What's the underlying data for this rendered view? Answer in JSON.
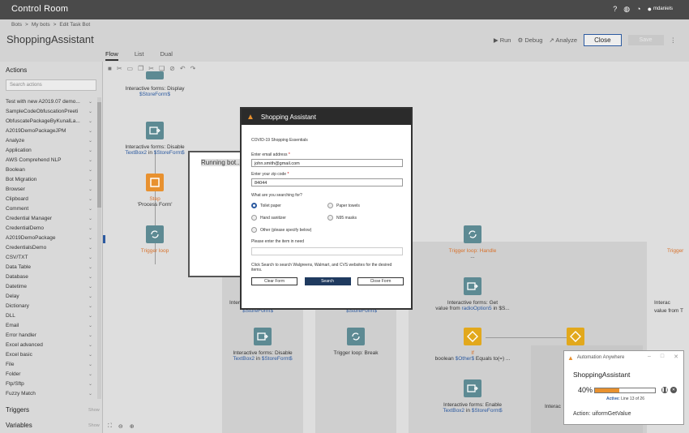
{
  "app": {
    "title": "Control Room",
    "user": "mdaniels"
  },
  "breadcrumb": [
    "Bots",
    ">",
    "My bots",
    ">",
    "Edit Task Bot"
  ],
  "page": {
    "title": "ShoppingAssistant"
  },
  "header_actions": {
    "run": "Run",
    "debug": "Debug",
    "analyze": "Analyze",
    "close": "Close",
    "save": "Save"
  },
  "tabs": [
    "Flow",
    "List",
    "Dual"
  ],
  "sidebar": {
    "title": "Actions",
    "search_placeholder": "Search actions",
    "items": [
      "Test with new A2019.07 demo...",
      "SampleCodeObfuscationPreeti",
      "ObfuscatePackageByKunalLa...",
      "A2019DemoPackageJPM",
      "Analyze",
      "Application",
      "AWS Comprehend NLP",
      "Boolean",
      "Bot Migration",
      "Browser",
      "Clipboard",
      "Comment",
      "Credential Manager",
      "CredentialDemo",
      "A2019DemoPackage",
      "CredentialsDemo",
      "CSV/TXT",
      "Data Table",
      "Database",
      "Datetime",
      "Delay",
      "Dictionary",
      "DLL",
      "Email",
      "Error handler",
      "Excel advanced",
      "Excel basic",
      "File",
      "Folder",
      "Ftp/Sftp",
      "Fuzzy Match"
    ],
    "triggers": "Triggers",
    "variables": "Variables",
    "show": "Show"
  },
  "flow": {
    "n1": {
      "title": "Interactive forms: Display",
      "var": "$StoreForm$"
    },
    "n2": {
      "title": "Interactive forms: Disable",
      "field": "TextBox2",
      "in": " in ",
      "var": "$StoreForm$"
    },
    "n3": {
      "title": "Step",
      "sub": "'Process Form'"
    },
    "n4": {
      "title": "Trigger loop"
    },
    "n5": {
      "title": "Trigger loop: Handle",
      "sub": "..."
    },
    "n6": {
      "title": "Interactive forms: Get",
      "sub": "value from ",
      "field": "radioOption5",
      "tail": " in $S..."
    },
    "n7": {
      "title": "Interactive forms: Disable",
      "field": "TextBox2",
      "in": " in ",
      "var": "$StoreForm$"
    },
    "n8": {
      "title": "Trigger loop: Break"
    },
    "n9": {
      "title": "If",
      "sub": "boolean ",
      "var": "$Other$",
      "tail": " Equals to(=) ..."
    },
    "n10": {
      "title": "Interactive forms: Enable",
      "field": "TextBox2",
      "in": " in ",
      "var": "$StoreForm$"
    },
    "frag1": "Intera",
    "frag2": "$StoreForm$",
    "frag3": "$StoreForm$",
    "frag4": "Interac",
    "frag5": "value from T",
    "frag6": "Trigger",
    "frag7": "Interac"
  },
  "running": {
    "text": "Running bot..."
  },
  "dialog": {
    "title": "Shopping Assistant",
    "heading": "COVID-19 Shopping Essentials",
    "email_label": "Enter email address",
    "email_value": "john.smith@gmail.com",
    "zip_label": "Enter your zip code",
    "zip_value": "84044",
    "question": "What are you searching for?",
    "options": [
      "Toilet paper",
      "Paper towels",
      "Hand sanitizer",
      "N95 masks",
      "Other (please specify below)"
    ],
    "other_label": "Please enter the item in need",
    "note": "Click Search to search Walgreens, Walmart, and CVS websites for the desired items.",
    "buttons": {
      "clear": "Clear Form",
      "search": "Search",
      "close": "Close Form"
    },
    "required_mark": "*"
  },
  "progress_panel": {
    "app": "Automation Anywhere",
    "bot": "ShoppingAssistant",
    "percent_label": "40%",
    "percent": 0.4,
    "status_key": "Active:",
    "status_val": " Line 13 of 26",
    "action": "Action:  uiformGetValue"
  },
  "colors": {
    "accent": "#2c5aa0",
    "orange": "#e8912f",
    "dark": "#4a4a4a"
  }
}
